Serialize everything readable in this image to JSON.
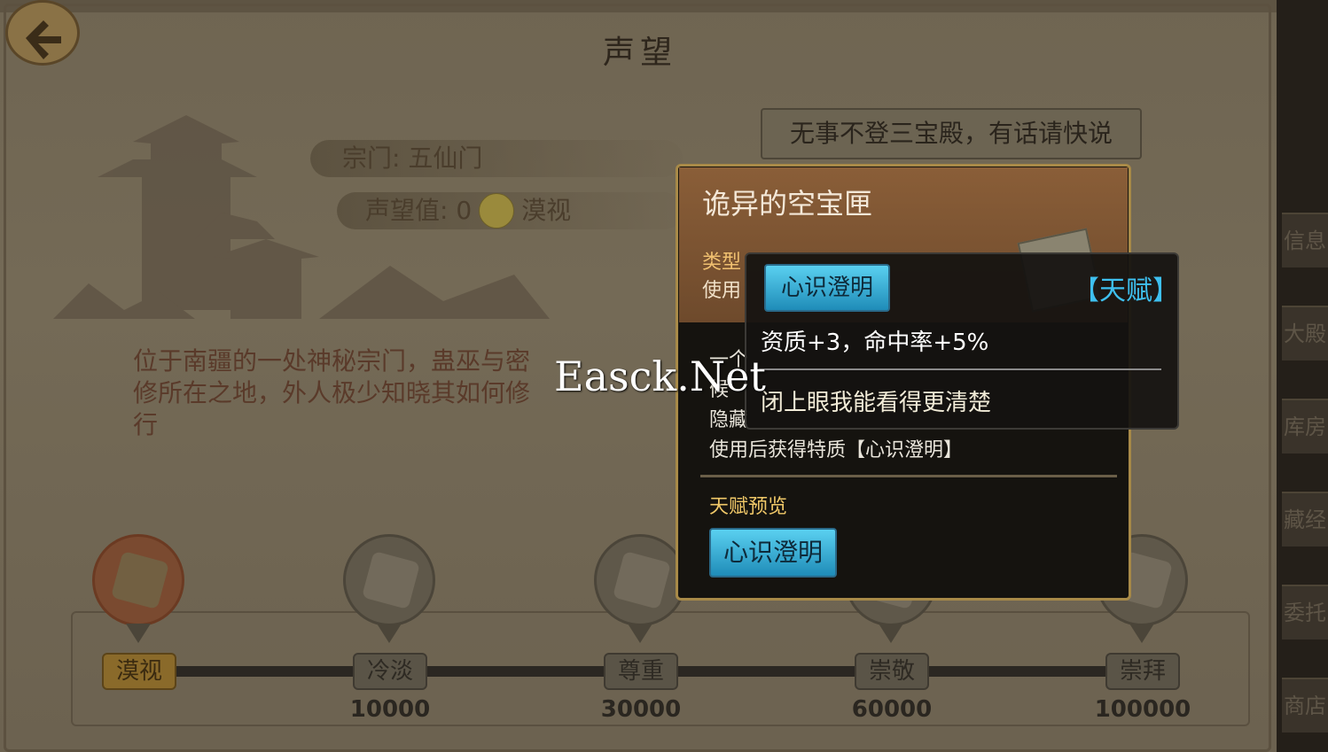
{
  "page": {
    "title": "声望"
  },
  "speech": "无事不登三宝殿，有话请快说",
  "sect": {
    "label": "宗门: 五仙门",
    "reputation_label": "声望值: 0",
    "reputation_rank": "漠视",
    "description": "位于南疆的一处神秘宗门，蛊巫与密修所在之地，外人极少知晓其如何修行"
  },
  "tiers": [
    {
      "name": "漠视",
      "value": "",
      "active": true
    },
    {
      "name": "冷淡",
      "value": "10000",
      "active": false
    },
    {
      "name": "尊重",
      "value": "30000",
      "active": false
    },
    {
      "name": "崇敬",
      "value": "60000",
      "active": false
    },
    {
      "name": "崇拜",
      "value": "100000",
      "active": false
    }
  ],
  "item_card": {
    "title": "诡异的空宝匣",
    "type_label": "类型",
    "use_label": "使用",
    "desc_line1": "一个",
    "desc_line2": "候",
    "desc_line3": "隐藏",
    "desc_line4": "使用后获得特质【心识澄明】",
    "preview_label": "天赋预览",
    "preview_button": "心识澄明"
  },
  "tooltip": {
    "talent_name": "心识澄明",
    "tag": "【天赋】",
    "stats": "资质+3，命中率+5%",
    "flavor": "闭上眼我能看得更清楚"
  },
  "side_tabs": [
    "信息",
    "大殿",
    "库房",
    "藏经",
    "委托",
    "商店"
  ],
  "watermark": "Easck.Net",
  "colors": {
    "talent_button": "#3fb4de",
    "tag_blue": "#3ec0f0",
    "card_border": "#a88a48"
  }
}
